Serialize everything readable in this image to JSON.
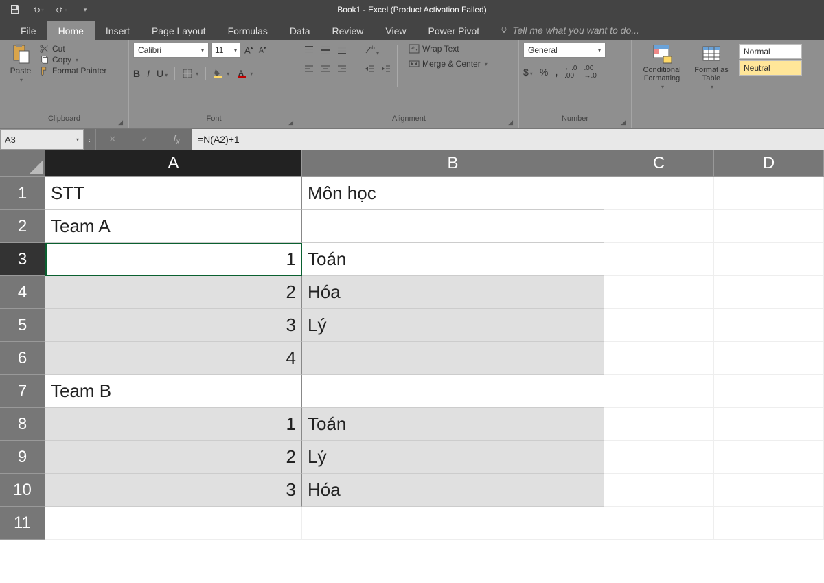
{
  "title": "Book1 - Excel (Product Activation Failed)",
  "tabs": [
    "File",
    "Home",
    "Insert",
    "Page Layout",
    "Formulas",
    "Data",
    "Review",
    "View",
    "Power Pivot"
  ],
  "tell_me": "Tell me what you want to do...",
  "ribbon": {
    "clipboard": {
      "paste": "Paste",
      "cut": "Cut",
      "copy": "Copy",
      "format_painter": "Format Painter",
      "label": "Clipboard"
    },
    "font": {
      "name": "Calibri",
      "size": "11",
      "label": "Font"
    },
    "alignment": {
      "wrap": "Wrap Text",
      "merge": "Merge & Center",
      "label": "Alignment"
    },
    "number": {
      "format": "General",
      "label": "Number"
    },
    "styles": {
      "cond": "Conditional Formatting",
      "table": "Format as Table",
      "normal": "Normal",
      "neutral": "Neutral"
    }
  },
  "namebox": "A3",
  "formula": "=N(A2)+1",
  "columns": [
    "A",
    "B",
    "C",
    "D"
  ],
  "rows": [
    {
      "n": "1",
      "a": "STT",
      "a_align": "left",
      "b": "Môn học",
      "gray": false
    },
    {
      "n": "2",
      "a": "Team A",
      "a_align": "left",
      "b": "",
      "gray": false
    },
    {
      "n": "3",
      "a": "1",
      "a_align": "right",
      "b": "Toán",
      "gray": false,
      "active": true
    },
    {
      "n": "4",
      "a": "2",
      "a_align": "right",
      "b": "Hóa",
      "gray": true
    },
    {
      "n": "5",
      "a": "3",
      "a_align": "right",
      "b": "Lý",
      "gray": true
    },
    {
      "n": "6",
      "a": "4",
      "a_align": "right",
      "b": "",
      "gray": true
    },
    {
      "n": "7",
      "a": "Team B",
      "a_align": "left",
      "b": "",
      "gray": false
    },
    {
      "n": "8",
      "a": "1",
      "a_align": "right",
      "b": "Toán",
      "gray": true
    },
    {
      "n": "9",
      "a": "2",
      "a_align": "right",
      "b": "Lý",
      "gray": true
    },
    {
      "n": "10",
      "a": "3",
      "a_align": "right",
      "b": "Hóa",
      "gray": true
    },
    {
      "n": "11",
      "a": "",
      "a_align": "left",
      "b": "",
      "gray": false,
      "outside": true
    }
  ]
}
